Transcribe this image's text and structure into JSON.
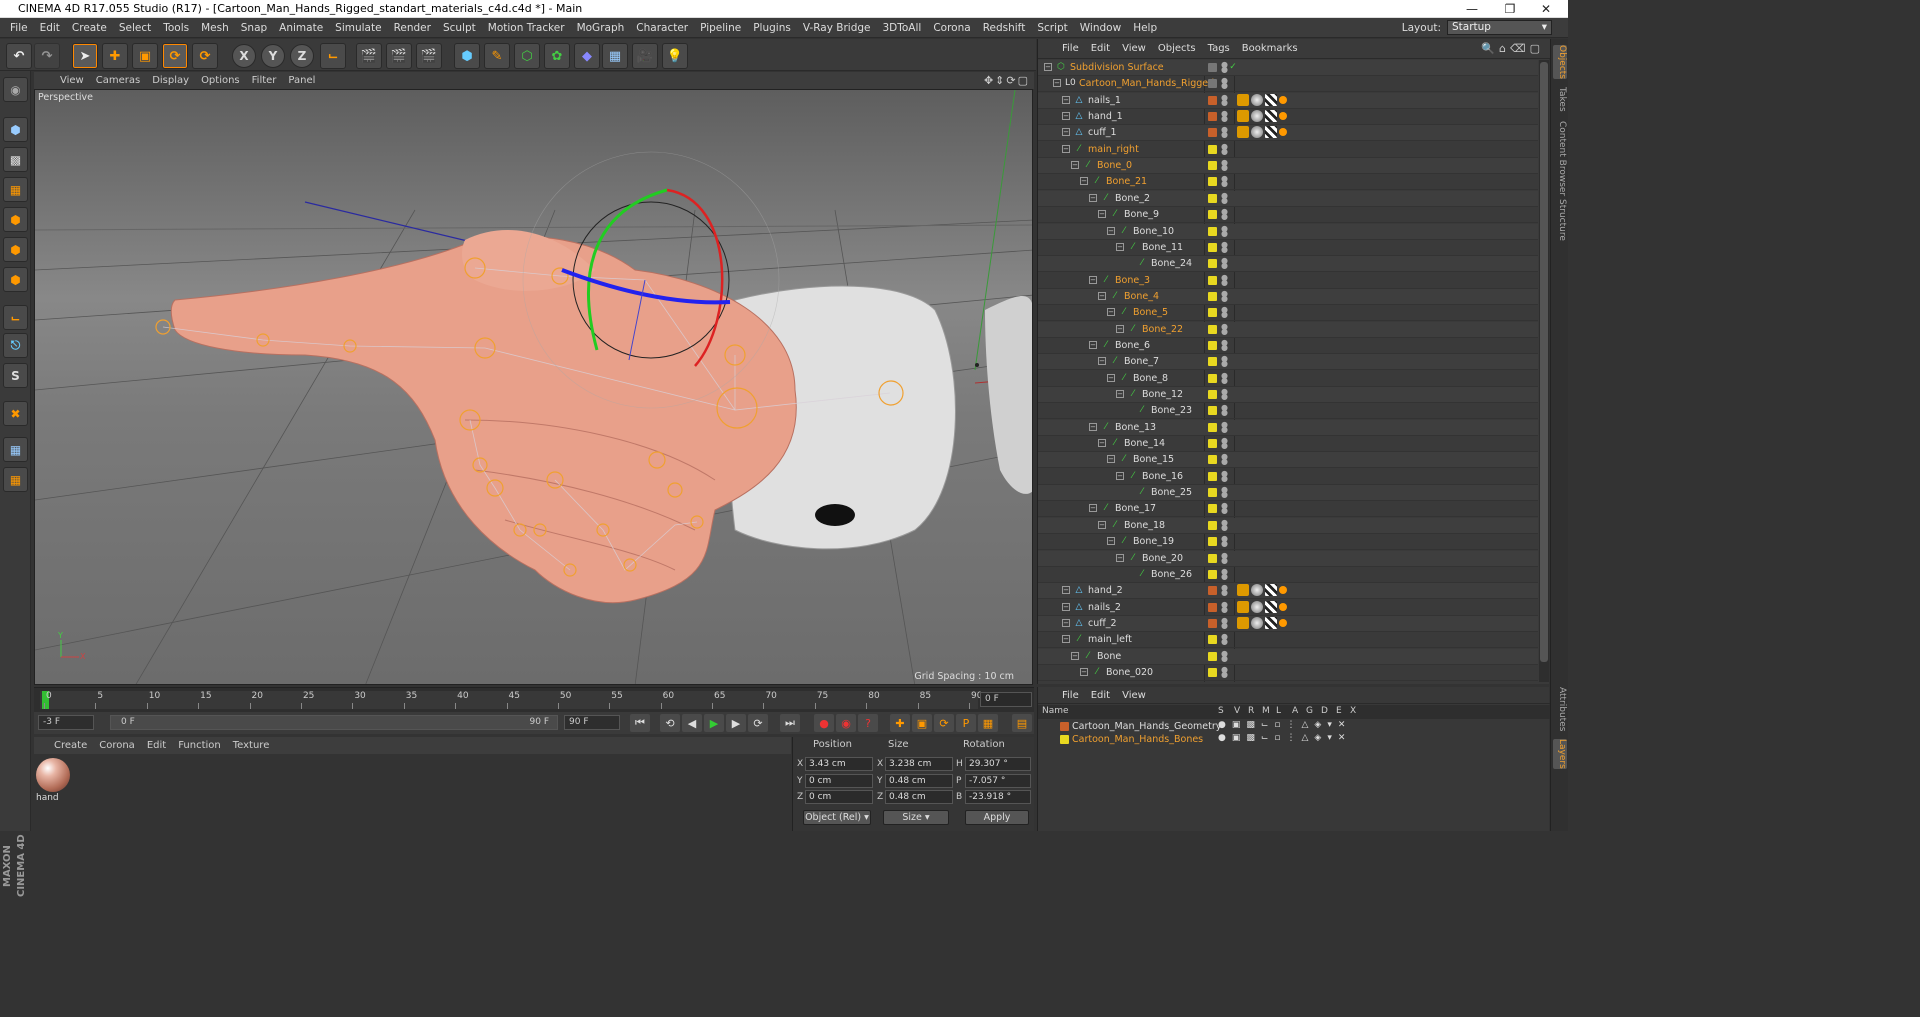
{
  "window": {
    "title": "CINEMA 4D R17.055 Studio (R17) - [Cartoon_Man_Hands_Rigged_standart_materials_c4d.c4d *] - Main"
  },
  "menu": [
    "File",
    "Edit",
    "Create",
    "Select",
    "Tools",
    "Mesh",
    "Snap",
    "Animate",
    "Simulate",
    "Render",
    "Sculpt",
    "Motion Tracker",
    "MoGraph",
    "Character",
    "Pipeline",
    "Plugins",
    "V-Ray Bridge",
    "3DToAll",
    "Corona",
    "Redshift",
    "Script",
    "Window",
    "Help"
  ],
  "layout": {
    "label": "Layout:",
    "value": "Startup"
  },
  "viewport": {
    "menu": [
      "View",
      "Cameras",
      "Display",
      "Options",
      "Filter",
      "Panel"
    ],
    "label": "Perspective",
    "grid_spacing": "Grid Spacing : 10 cm"
  },
  "timeline": {
    "ticks": [
      "0",
      "5",
      "10",
      "15",
      "20",
      "25",
      "30",
      "35",
      "40",
      "45",
      "50",
      "55",
      "60",
      "65",
      "70",
      "75",
      "80",
      "85",
      "90"
    ],
    "current_frame": "0 F",
    "min_frame": "-3 F",
    "range_start": "0 F",
    "range_end": "90 F",
    "max_frame": "90 F"
  },
  "material": {
    "menu": [
      "Create",
      "Corona",
      "Edit",
      "Function",
      "Texture"
    ],
    "name": "hand"
  },
  "coords": {
    "headers": [
      "Position",
      "Size",
      "Rotation"
    ],
    "rows": [
      {
        "axis": "X",
        "pos": "3.43 cm",
        "saxis": "X",
        "size": "3.238 cm",
        "raxis": "H",
        "rot": "29.307 °"
      },
      {
        "axis": "Y",
        "pos": "0 cm",
        "saxis": "Y",
        "size": "0.48 cm",
        "raxis": "P",
        "rot": "-7.057 °"
      },
      {
        "axis": "Z",
        "pos": "0 cm",
        "saxis": "Z",
        "size": "0.48 cm",
        "raxis": "B",
        "rot": "-23.918 °"
      }
    ],
    "mode": "Object (Rel)",
    "size_mode": "Size",
    "apply": "Apply"
  },
  "objects": {
    "menu": [
      "File",
      "Edit",
      "View",
      "Objects",
      "Tags",
      "Bookmarks"
    ],
    "items": [
      {
        "name": "Subdivision Surface",
        "indent": 0,
        "type": "subd",
        "sel": true
      },
      {
        "name": "Cartoon_Man_Hands_Rigged",
        "indent": 1,
        "type": "null",
        "sel": true
      },
      {
        "name": "nails_1",
        "indent": 2,
        "type": "poly",
        "color": "#c8602a",
        "tags": true
      },
      {
        "name": "hand_1",
        "indent": 2,
        "type": "poly",
        "color": "#c8602a",
        "tags": true
      },
      {
        "name": "cuff_1",
        "indent": 2,
        "type": "poly",
        "color": "#c8602a",
        "tags": true
      },
      {
        "name": "main_right",
        "indent": 2,
        "type": "bone",
        "color": "#e8d820",
        "sel": true
      },
      {
        "name": "Bone_0",
        "indent": 3,
        "type": "bone",
        "color": "#e8d820",
        "sel": true
      },
      {
        "name": "Bone_21",
        "indent": 4,
        "type": "bone",
        "color": "#e8d820",
        "sel": true
      },
      {
        "name": "Bone_2",
        "indent": 5,
        "type": "bone",
        "color": "#e8d820"
      },
      {
        "name": "Bone_9",
        "indent": 6,
        "type": "bone",
        "color": "#e8d820"
      },
      {
        "name": "Bone_10",
        "indent": 7,
        "type": "bone",
        "color": "#e8d820"
      },
      {
        "name": "Bone_11",
        "indent": 8,
        "type": "bone",
        "color": "#e8d820"
      },
      {
        "name": "Bone_24",
        "indent": 9,
        "type": "bone",
        "color": "#e8d820"
      },
      {
        "name": "Bone_3",
        "indent": 5,
        "type": "bone",
        "color": "#e8d820",
        "sel": true
      },
      {
        "name": "Bone_4",
        "indent": 6,
        "type": "bone",
        "color": "#e8d820",
        "sel": true
      },
      {
        "name": "Bone_5",
        "indent": 7,
        "type": "bone",
        "color": "#e8d820",
        "sel": true
      },
      {
        "name": "Bone_22",
        "indent": 8,
        "type": "bone",
        "color": "#e8d820",
        "sel": true
      },
      {
        "name": "Bone_6",
        "indent": 5,
        "type": "bone",
        "color": "#e8d820"
      },
      {
        "name": "Bone_7",
        "indent": 6,
        "type": "bone",
        "color": "#e8d820"
      },
      {
        "name": "Bone_8",
        "indent": 7,
        "type": "bone",
        "color": "#e8d820"
      },
      {
        "name": "Bone_12",
        "indent": 8,
        "type": "bone",
        "color": "#e8d820"
      },
      {
        "name": "Bone_23",
        "indent": 9,
        "type": "bone",
        "color": "#e8d820"
      },
      {
        "name": "Bone_13",
        "indent": 5,
        "type": "bone",
        "color": "#e8d820"
      },
      {
        "name": "Bone_14",
        "indent": 6,
        "type": "bone",
        "color": "#e8d820"
      },
      {
        "name": "Bone_15",
        "indent": 7,
        "type": "bone",
        "color": "#e8d820"
      },
      {
        "name": "Bone_16",
        "indent": 8,
        "type": "bone",
        "color": "#e8d820"
      },
      {
        "name": "Bone_25",
        "indent": 9,
        "type": "bone",
        "color": "#e8d820"
      },
      {
        "name": "Bone_17",
        "indent": 5,
        "type": "bone",
        "color": "#e8d820"
      },
      {
        "name": "Bone_18",
        "indent": 6,
        "type": "bone",
        "color": "#e8d820"
      },
      {
        "name": "Bone_19",
        "indent": 7,
        "type": "bone",
        "color": "#e8d820"
      },
      {
        "name": "Bone_20",
        "indent": 8,
        "type": "bone",
        "color": "#e8d820"
      },
      {
        "name": "Bone_26",
        "indent": 9,
        "type": "bone",
        "color": "#e8d820"
      },
      {
        "name": "hand_2",
        "indent": 2,
        "type": "poly",
        "color": "#c8602a",
        "tags": true
      },
      {
        "name": "nails_2",
        "indent": 2,
        "type": "poly",
        "color": "#c8602a",
        "tags": true
      },
      {
        "name": "cuff_2",
        "indent": 2,
        "type": "poly",
        "color": "#c8602a",
        "tags": true
      },
      {
        "name": "main_left",
        "indent": 2,
        "type": "bone",
        "color": "#e8d820"
      },
      {
        "name": "Bone",
        "indent": 3,
        "type": "bone",
        "color": "#e8d820"
      },
      {
        "name": "Bone_020",
        "indent": 4,
        "type": "bone",
        "color": "#e8d820"
      }
    ]
  },
  "layers": {
    "menu": [
      "File",
      "Edit",
      "View"
    ],
    "columns": [
      "Name",
      "S",
      "V",
      "R",
      "M",
      "L",
      "A",
      "G",
      "D",
      "E",
      "X"
    ],
    "items": [
      {
        "name": "Cartoon_Man_Hands_Geometry",
        "color": "#c8602a",
        "sel": false
      },
      {
        "name": "Cartoon_Man_Hands_Bones",
        "color": "#e8d820",
        "sel": true
      }
    ]
  },
  "right_tabs": [
    "Objects",
    "Takes",
    "Content Browser",
    "Structure",
    "Attributes",
    "Layers"
  ],
  "colors": {
    "accent": "#f0a030",
    "bg": "#333333"
  }
}
